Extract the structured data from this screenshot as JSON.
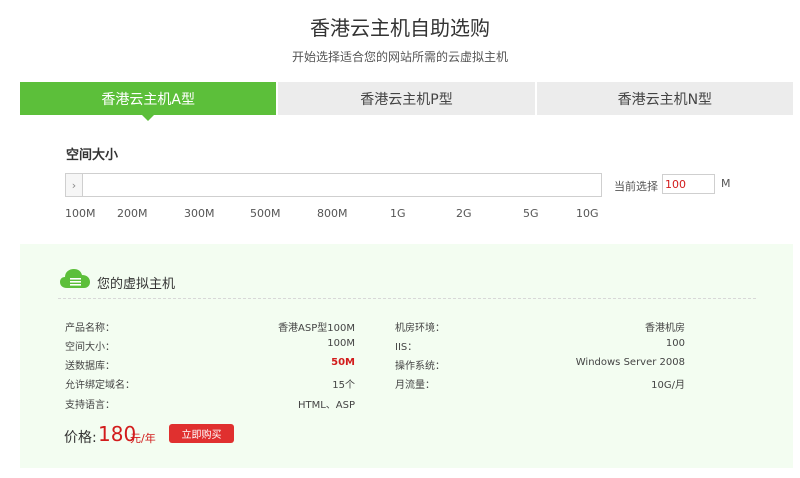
{
  "header": {
    "title": "香港云主机自助选购",
    "subtitle": "开始选择适合您的网站所需的云虚拟主机"
  },
  "tabs": [
    {
      "label": "香港云主机A型",
      "active": true
    },
    {
      "label": "香港云主机P型",
      "active": false
    },
    {
      "label": "香港云主机N型",
      "active": false
    }
  ],
  "space": {
    "label": "空间大小",
    "current_label": "当前选择",
    "current_value": "100",
    "unit": "M",
    "handle_glyph": "›",
    "ticks": [
      "100M",
      "200M",
      "300M",
      "500M",
      "800M",
      "1G",
      "2G",
      "5G",
      "10G"
    ]
  },
  "product": {
    "title": "您的虚拟主机",
    "left_rows": [
      {
        "label": "产品名称：",
        "value": "香港ASP型100M"
      },
      {
        "label": "空间大小：",
        "value": "100M"
      },
      {
        "label": "送数据库：",
        "value": "50M"
      },
      {
        "label": "允许绑定域名：",
        "value": "15个"
      },
      {
        "label": "支持语言：",
        "value": "HTML、ASP"
      }
    ],
    "right_rows": [
      {
        "label": "机房环境：",
        "value": "香港机房"
      },
      {
        "label": "IIS：",
        "value": "100"
      },
      {
        "label": "操作系统：",
        "value": "Windows Server 2008"
      },
      {
        "label": "月流量：",
        "value": "10G/月"
      }
    ],
    "price_label": "价格:",
    "price_value": "180",
    "price_unit": "元/年",
    "buy_label": "立即购买"
  },
  "colors": {
    "accent": "#5cbf3a",
    "price": "#d21c1c",
    "buy_button": "#e0302f",
    "panel_bg": "#f3fdf1"
  }
}
